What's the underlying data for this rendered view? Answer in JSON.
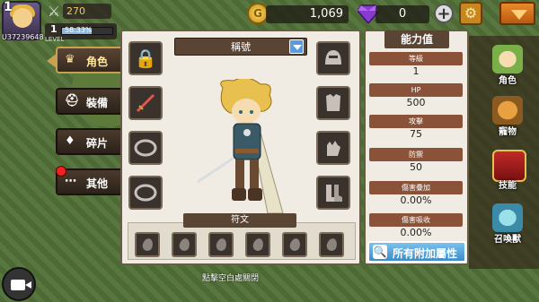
{
  "player": {
    "level": "1",
    "uid": "U37239648",
    "power": "270",
    "level_small": "1",
    "level_tag": "LEVEL",
    "exp_text": "58.33%",
    "exp_fraction": 0.5833
  },
  "currency": {
    "gold": "1,069",
    "gold_symbol": "G",
    "gems": "0"
  },
  "tabs": [
    {
      "label": "角色",
      "icon": "crown-icon"
    },
    {
      "label": "裝備",
      "icon": "helmet-icon"
    },
    {
      "label": "碎片",
      "icon": "shard-icon"
    },
    {
      "label": "其他",
      "icon": "dots-icon"
    }
  ],
  "title_select": {
    "value": "稱號"
  },
  "runes": {
    "title": "符文",
    "count": 6
  },
  "hint": "點擊空白處關閉",
  "stats": {
    "title": "能力值",
    "items": [
      {
        "label": "等級",
        "value": "1"
      },
      {
        "label": "HP",
        "value": "500"
      },
      {
        "label": "攻擊",
        "value": "75"
      },
      {
        "label": "防禦",
        "value": "50"
      },
      {
        "label": "傷害疊加",
        "value": "0.00%"
      },
      {
        "label": "傷害吸收",
        "value": "0.00%"
      }
    ],
    "all_button": "所有附加屬性"
  },
  "side_menu": [
    {
      "label": "角色",
      "icon": "character-icon"
    },
    {
      "label": "寵物",
      "icon": "pet-icon"
    },
    {
      "label": "技能",
      "icon": "skill-book-icon"
    },
    {
      "label": "召喚獸",
      "icon": "summon-icon"
    }
  ],
  "colors": {
    "accent": "#c8a050",
    "panel": "#f1ece3",
    "label_bg": "#8a5238",
    "button_blue": "#3a8cc8"
  }
}
